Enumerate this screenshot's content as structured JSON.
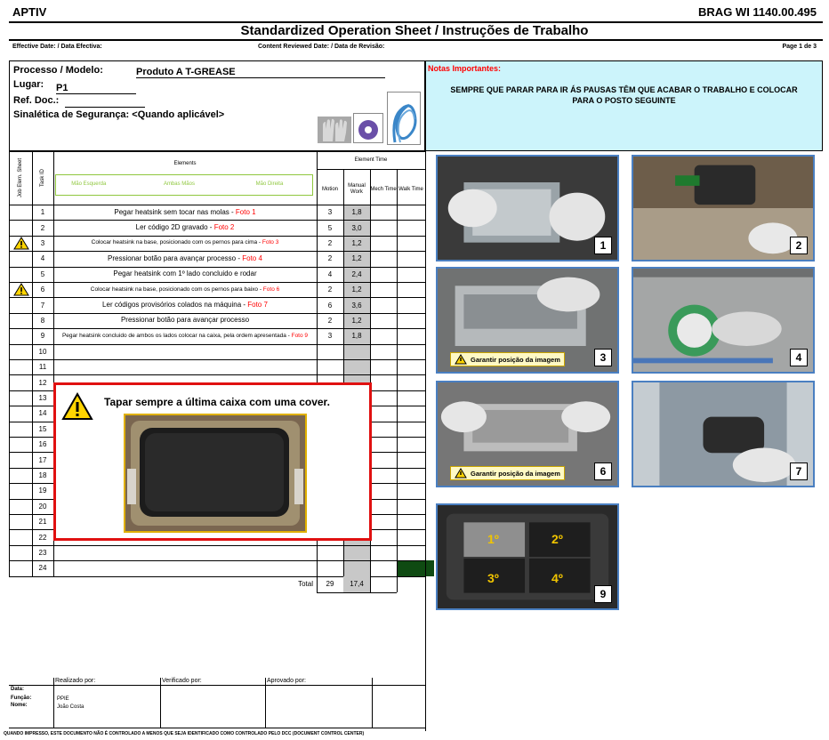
{
  "header": {
    "brand": "APTIV",
    "doc_number": "BRAG WI 1140.00.495",
    "title": "Standardized Operation Sheet / Instruções de Trabalho",
    "effective_date_label": "Effective Date: / Data Efectiva:",
    "reviewed_date_label": "Content Reviewed Date: / Data de Revisão:",
    "page": "Page 1 de 3"
  },
  "process": {
    "processo_label": "Processo / Modelo:",
    "processo_value": "Produto A T-GREASE",
    "lugar_label": "Lugar:",
    "lugar_value": "P1",
    "ref_label": "Ref. Doc.:",
    "sinaletica_label": "Sinalética de Segurança: <Quando aplicável>",
    "safety_icons": [
      "gloves-icon",
      "ear-protection-icon",
      "cable-icon"
    ]
  },
  "notes": {
    "title": "Notas Importantes:",
    "text": "SEMPRE QUE PARAR PARA IR ÁS PAUSAS TÊM QUE ACABAR O TRABALHO E COLOCAR PARA O POSTO SEGUINTE"
  },
  "table": {
    "col_job": "Job Elem. Sheet",
    "col_task": "Task ID",
    "col_elements": "Elements",
    "col_element_time": "Element Time",
    "hand_left": "Mão Esquerda",
    "hand_both": "Ambas Mãos",
    "hand_right": "Mão Direita",
    "col_motion": "Motion",
    "col_manual": "Manual Work",
    "col_mech": "Mech Time",
    "col_walk": "Walk Time",
    "rows": [
      {
        "id": "1",
        "text": "Pegar heatsink sem tocar nas molas - ",
        "foto": "Foto 1",
        "motion": "3",
        "manual": "1,8",
        "warn": false,
        "small": false
      },
      {
        "id": "2",
        "text": "Ler código 2D gravado - ",
        "foto": "Foto 2",
        "motion": "5",
        "manual": "3,0",
        "warn": false,
        "small": false
      },
      {
        "id": "3",
        "text": "Colocar heatsink na base, posicionado com os pernos para cima - ",
        "foto": "Foto 3",
        "motion": "2",
        "manual": "1,2",
        "warn": true,
        "small": true
      },
      {
        "id": "4",
        "text": "Pressionar botão para avançar processo  - ",
        "foto": "Foto 4",
        "motion": "2",
        "manual": "1,2",
        "warn": false,
        "small": false
      },
      {
        "id": "5",
        "text": "Pegar heatsink com 1º lado concluido e rodar",
        "foto": "",
        "motion": "4",
        "manual": "2,4",
        "warn": false,
        "small": false
      },
      {
        "id": "6",
        "text": "Colocar heatsink na base, posicionado com os pernos para baixo - ",
        "foto": "Foto 6",
        "motion": "2",
        "manual": "1,2",
        "warn": true,
        "small": true
      },
      {
        "id": "7",
        "text": "Ler códigos provisórios colados na máquina  - ",
        "foto": "Foto 7",
        "motion": "6",
        "manual": "3,6",
        "warn": false,
        "small": false
      },
      {
        "id": "8",
        "text": "Pressionar botão para avançar processo",
        "foto": "",
        "motion": "2",
        "manual": "1,2",
        "warn": false,
        "small": false
      },
      {
        "id": "9",
        "text": "Pegar heatsink concluido de ambos os lados colocar na caixa, pela ordem apresentada - ",
        "foto": "Foto 9",
        "motion": "3",
        "manual": "1,8",
        "warn": false,
        "small": true
      },
      {
        "id": "10"
      },
      {
        "id": "11"
      },
      {
        "id": "12"
      },
      {
        "id": "13"
      },
      {
        "id": "14"
      },
      {
        "id": "15"
      },
      {
        "id": "16"
      },
      {
        "id": "17"
      },
      {
        "id": "18"
      },
      {
        "id": "19"
      },
      {
        "id": "20"
      },
      {
        "id": "21"
      },
      {
        "id": "22"
      },
      {
        "id": "23"
      },
      {
        "id": "24"
      }
    ],
    "total_label": "Total",
    "total_motion": "29",
    "total_manual": "17,4"
  },
  "overlay": {
    "text": "Tapar sempre a última caixa com uma cover."
  },
  "photos": [
    {
      "num": "1",
      "warn": ""
    },
    {
      "num": "2",
      "warn": ""
    },
    {
      "num": "3",
      "warn": "Garantir posição da imagem"
    },
    {
      "num": "4",
      "warn": ""
    },
    {
      "num": "6",
      "warn": "Garantir posição da imagem"
    },
    {
      "num": "7",
      "warn": ""
    },
    {
      "num": "9",
      "warn": "",
      "labels": [
        "1º",
        "2º",
        "3º",
        "4º"
      ]
    }
  ],
  "signatures": {
    "realizado": "Realizado por:",
    "verificado": "Verificado por:",
    "aprovado": "Aprovado por:",
    "data_label": "Data:",
    "funcao_label": "Função:",
    "nome_label": "Nome:",
    "funcao_value": "PPIE",
    "nome_value": "João Costa"
  },
  "footer": "QUANDO IMPRESSO, ESTE DOCUMENTO NÃO É CONTROLADO A MENOS QUE SEJA IDENTIFICADO COMO CONTROLADO PELO DCC (DOCUMENT CONTROL CENTER)",
  "colors": {
    "accent_red": "#ff0000",
    "notes_bg": "#ccf4fb",
    "photo_border": "#4a7fc1",
    "hand_green": "#8fc73e"
  }
}
